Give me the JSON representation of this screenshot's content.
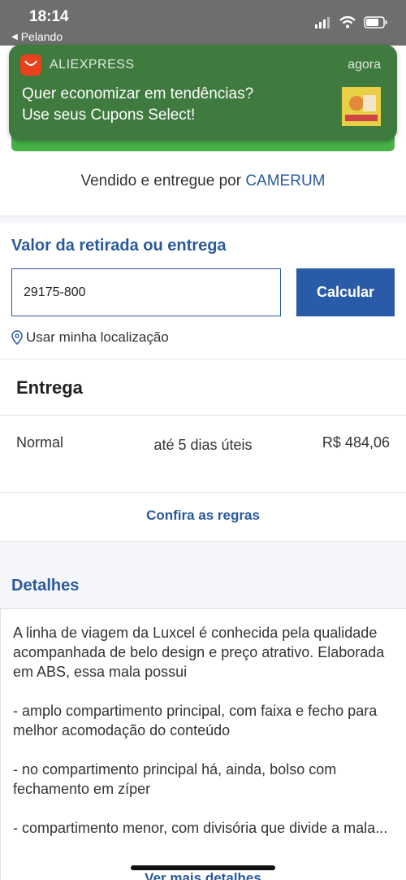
{
  "status": {
    "time": "18:14",
    "back_app": "Pelando"
  },
  "notification": {
    "app_name": "ALIEXPRESS",
    "time": "agora",
    "title": "Quer economizar em tendências?",
    "body": "Use seus Cupons Select!",
    "icon_label": "AliCupons"
  },
  "seller": {
    "prefix": "Vendido e entregue por",
    "name": "CAMERUM"
  },
  "shipping_calc": {
    "title": "Valor da retirada ou entrega",
    "cep_value": "29175-800",
    "button": "Calcular",
    "location_link": "Usar minha localização"
  },
  "delivery": {
    "title": "Entrega",
    "options": [
      {
        "type": "Normal",
        "time": "até 5 dias úteis",
        "price": "R$ 484,06"
      }
    ],
    "rules_link": "Confira as regras"
  },
  "details": {
    "title": "Detalhes",
    "paragraphs": [
      "A linha de viagem da Luxcel é conhecida pela qualidade acompanhada de belo design e preço atrativo. Elaborada em ABS, essa mala possui",
      "- amplo compartimento principal, com faixa e fecho para melhor acomodação do conteúdo",
      "- no compartimento principal há, ainda, bolso com fechamento em zíper",
      "- compartimento menor, com divisória que divide a mala..."
    ],
    "more_link": "Ver mais detalhes"
  },
  "colors": {
    "accent": "#2a5a9c",
    "notification_bg": "#3f7a3f",
    "button": "#2a5ba8"
  }
}
